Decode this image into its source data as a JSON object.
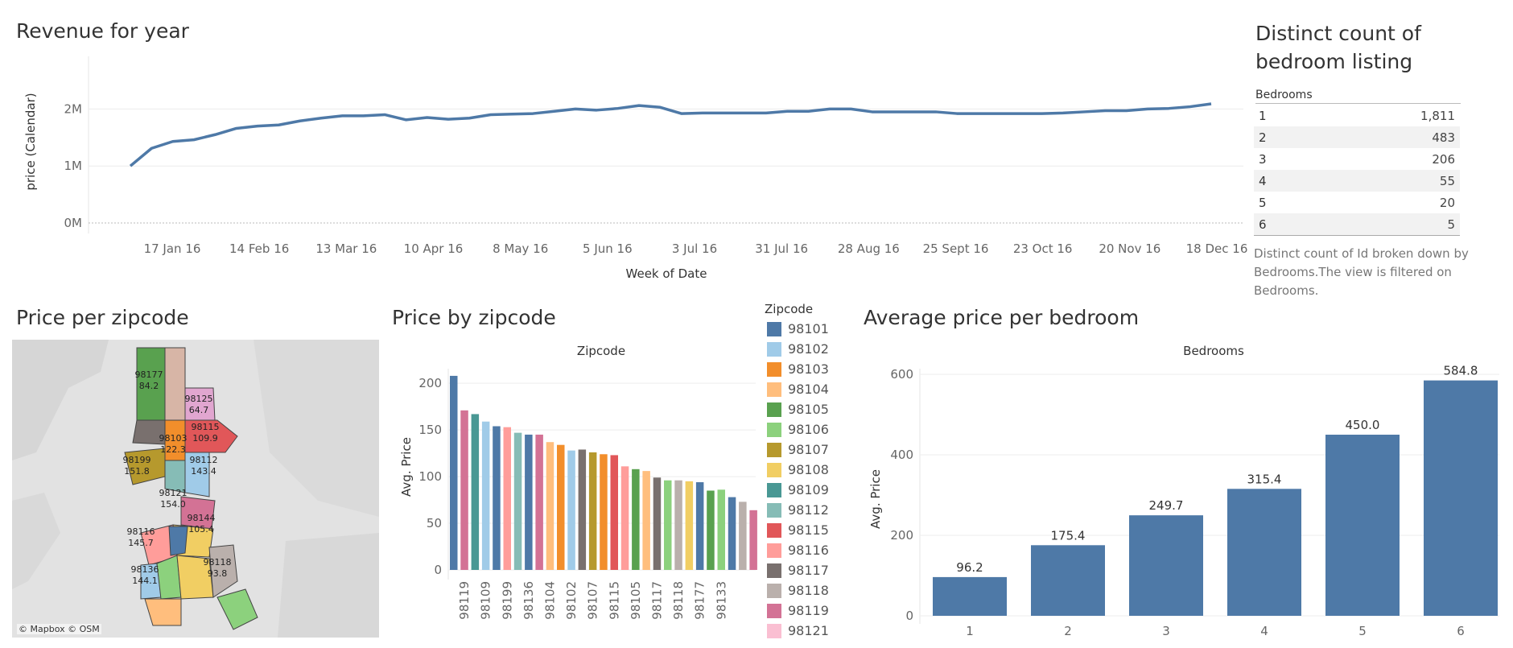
{
  "revenue": {
    "title": "Revenue for year",
    "chart_data": {
      "type": "line",
      "title": "Revenue for year",
      "xlabel": "Week of Date",
      "ylabel": "price (Calendar)",
      "y_ticks": [
        "0M",
        "1M",
        "2M"
      ],
      "x_ticks": [
        "17 Jan 16",
        "14 Feb 16",
        "13 Mar 16",
        "10 Apr 16",
        "8 May 16",
        "5 Jun 16",
        "3 Jul 16",
        "31 Jul 16",
        "28 Aug 16",
        "25 Sept 16",
        "23 Oct 16",
        "20 Nov 16",
        "18 Dec 16"
      ],
      "ylim": [
        0,
        2500000
      ],
      "values": [
        1000000,
        1310000,
        1430000,
        1460000,
        1550000,
        1660000,
        1700000,
        1720000,
        1790000,
        1840000,
        1880000,
        1880000,
        1900000,
        1810000,
        1850000,
        1820000,
        1840000,
        1900000,
        1910000,
        1920000,
        1960000,
        2000000,
        1980000,
        2010000,
        2060000,
        2030000,
        1920000,
        1930000,
        1930000,
        1930000,
        1930000,
        1960000,
        1960000,
        2000000,
        2000000,
        1950000,
        1950000,
        1950000,
        1950000,
        1920000,
        1920000,
        1920000,
        1920000,
        1920000,
        1930000,
        1950000,
        1970000,
        1970000,
        2000000,
        2010000,
        2040000,
        2090000
      ]
    }
  },
  "bedroom_table": {
    "title_line1": "Distinct count of",
    "title_line2": "bedroom listing",
    "header": "Bedrooms",
    "rows": [
      {
        "k": "1",
        "v": "1,811"
      },
      {
        "k": "2",
        "v": "483"
      },
      {
        "k": "3",
        "v": "206"
      },
      {
        "k": "4",
        "v": "55"
      },
      {
        "k": "5",
        "v": "20"
      },
      {
        "k": "6",
        "v": "5"
      }
    ],
    "caption_line1": "Distinct count of Id broken down by",
    "caption_line2": "Bedrooms.The view is filtered on Bedrooms."
  },
  "map": {
    "title": "Price per zipcode",
    "attribution": "© Mapbox © OSM",
    "labels": [
      {
        "zip": "98177",
        "val": "84.2"
      },
      {
        "zip": "98125",
        "val": "64.7"
      },
      {
        "zip": "98115",
        "val": "109.9"
      },
      {
        "zip": "98103",
        "val": "122.3"
      },
      {
        "zip": "98199",
        "val": "151.8"
      },
      {
        "zip": "98112",
        "val": "143.4"
      },
      {
        "zip": "98121",
        "val": "154.0"
      },
      {
        "zip": "98144",
        "val": "105.4"
      },
      {
        "zip": "98116",
        "val": "145.7"
      },
      {
        "zip": "98118",
        "val": "93.8"
      },
      {
        "zip": "98136",
        "val": "144.1"
      }
    ]
  },
  "zip_chart": {
    "title": "Price by zipcode",
    "chart_data": {
      "type": "bar",
      "title": "Price by zipcode",
      "xlabel": "Zipcode",
      "ylabel": "Avg. Price",
      "ylim": [
        0,
        220
      ],
      "y_ticks": [
        0,
        50,
        100,
        150,
        200
      ],
      "categories": [
        "98101",
        "98119",
        "98109",
        "98102",
        "98199",
        "98116",
        "98112",
        "98136",
        "98119",
        "98104",
        "98103",
        "98102",
        "98117",
        "98107",
        "98103",
        "98115",
        "98116",
        "98105",
        "98104",
        "98117",
        "98106",
        "98118",
        "98108",
        "98177",
        "98105",
        "98106",
        "98133",
        "98118",
        "98119"
      ],
      "tick_labels": [
        "98119",
        "98109",
        "98199",
        "98136",
        "98104",
        "98102",
        "98107",
        "98115",
        "98105",
        "98117",
        "98118",
        "98177",
        "98133"
      ],
      "values": [
        208,
        171,
        167,
        159,
        154,
        153,
        147,
        145,
        145,
        137,
        134,
        128,
        129,
        126,
        124,
        123,
        111,
        108,
        106,
        99,
        96,
        96,
        95,
        94,
        85,
        86,
        78,
        73,
        64
      ]
    }
  },
  "legend": {
    "title": "Zipcode",
    "items": [
      {
        "label": "98101",
        "color": "#4e79a7"
      },
      {
        "label": "98102",
        "color": "#a0cbe8"
      },
      {
        "label": "98103",
        "color": "#f28e2b"
      },
      {
        "label": "98104",
        "color": "#ffbe7d"
      },
      {
        "label": "98105",
        "color": "#59a14f"
      },
      {
        "label": "98106",
        "color": "#8cd17d"
      },
      {
        "label": "98107",
        "color": "#b6992d"
      },
      {
        "label": "98108",
        "color": "#f1ce63"
      },
      {
        "label": "98109",
        "color": "#499894"
      },
      {
        "label": "98112",
        "color": "#86bcb6"
      },
      {
        "label": "98115",
        "color": "#e15759"
      },
      {
        "label": "98116",
        "color": "#ff9d9a"
      },
      {
        "label": "98117",
        "color": "#79706e"
      },
      {
        "label": "98118",
        "color": "#bab0ac"
      },
      {
        "label": "98119",
        "color": "#d37295"
      },
      {
        "label": "98121",
        "color": "#fabfd2"
      }
    ]
  },
  "bedroom_chart": {
    "title": "Average price per bedroom",
    "chart_data": {
      "type": "bar",
      "title": "Average price per bedroom",
      "xlabel": "Bedrooms",
      "ylabel": "Avg. Price",
      "ylim": [
        0,
        640
      ],
      "y_ticks": [
        0,
        200,
        400,
        600
      ],
      "categories": [
        "1",
        "2",
        "3",
        "4",
        "5",
        "6"
      ],
      "values": [
        96.2,
        175.4,
        249.7,
        315.4,
        450.0,
        584.8
      ],
      "labels": [
        "96.2",
        "175.4",
        "249.7",
        "315.4",
        "450.0",
        "584.8"
      ],
      "color": "#4e79a7"
    }
  }
}
